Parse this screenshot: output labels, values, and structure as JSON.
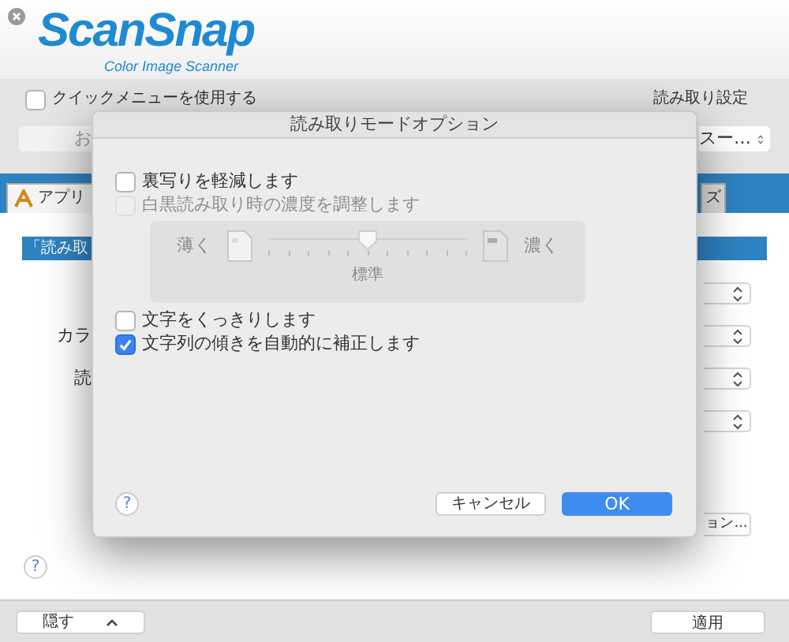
{
  "window": {
    "logo": "ScanSnap",
    "logo_subtitle": "Color Image Scanner"
  },
  "quick_menu": {
    "label": "クイックメニューを使用する",
    "checked": false
  },
  "settings_label": "読み取り設定",
  "profile_field": {
    "value": "お"
  },
  "profile_select": {
    "value": "スー…"
  },
  "tabs": [
    {
      "label": "アプリ",
      "selected": true
    },
    {
      "label": "ズ",
      "selected": false
    }
  ],
  "section_header": "「読み取",
  "form_labels": [
    "カラ",
    "読"
  ],
  "option_button": "ョン...",
  "help_label": "?",
  "hide_button": "隠す",
  "apply_button": "適用",
  "dialog": {
    "title": "読み取りモードオプション",
    "options": [
      {
        "label": "裏写りを軽減します",
        "checked": false,
        "disabled": false
      },
      {
        "label": "白黒読み取り時の濃度を調整します",
        "checked": false,
        "disabled": true
      },
      {
        "label": "文字をくっきりします",
        "checked": false,
        "disabled": false
      },
      {
        "label": "文字列の傾きを自動的に補正します",
        "checked": true,
        "disabled": false
      }
    ],
    "density": {
      "light_label": "薄く",
      "dark_label": "濃く",
      "center_label": "標準",
      "level": 0.5,
      "disabled": true
    },
    "cancel_button": "キャンセル",
    "ok_button": "OK",
    "help_label": "?"
  }
}
